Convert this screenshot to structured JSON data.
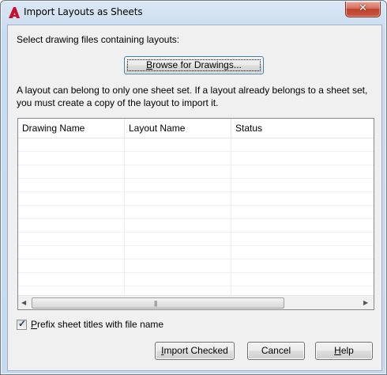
{
  "window": {
    "title": "Import Layouts as Sheets",
    "close_glyph": "✕"
  },
  "select_label": "Select drawing files containing layouts:",
  "browse_button": {
    "label_pre": "",
    "label_mnemonic": "B",
    "label_post": "rowse for Drawings..."
  },
  "info_text": "A layout can belong to only one sheet set. If a layout already belongs to a sheet set, you must create a copy of the layout to import it.",
  "table": {
    "columns": [
      "Drawing Name",
      "Layout Name",
      "Status"
    ],
    "rows": []
  },
  "scrollbar": {
    "left_arrow": "◀",
    "right_arrow": "▶",
    "grip": "|||"
  },
  "prefix_checkbox": {
    "checked": true,
    "label_mnemonic": "P",
    "label_post": "refix sheet titles with file name"
  },
  "buttons": {
    "import": {
      "label_mnemonic": "I",
      "label_post": "mport Checked"
    },
    "cancel": {
      "label": "Cancel"
    },
    "help": {
      "label_mnemonic": "H",
      "label_post": "elp"
    }
  },
  "icons": {
    "app": "autocad-logo-icon",
    "close": "close-icon",
    "check": "checkmark-icon"
  },
  "colors": {
    "app_icon_red": "#c8102e",
    "close_red": "#c0422d",
    "title_bar": "#c9dcef"
  }
}
